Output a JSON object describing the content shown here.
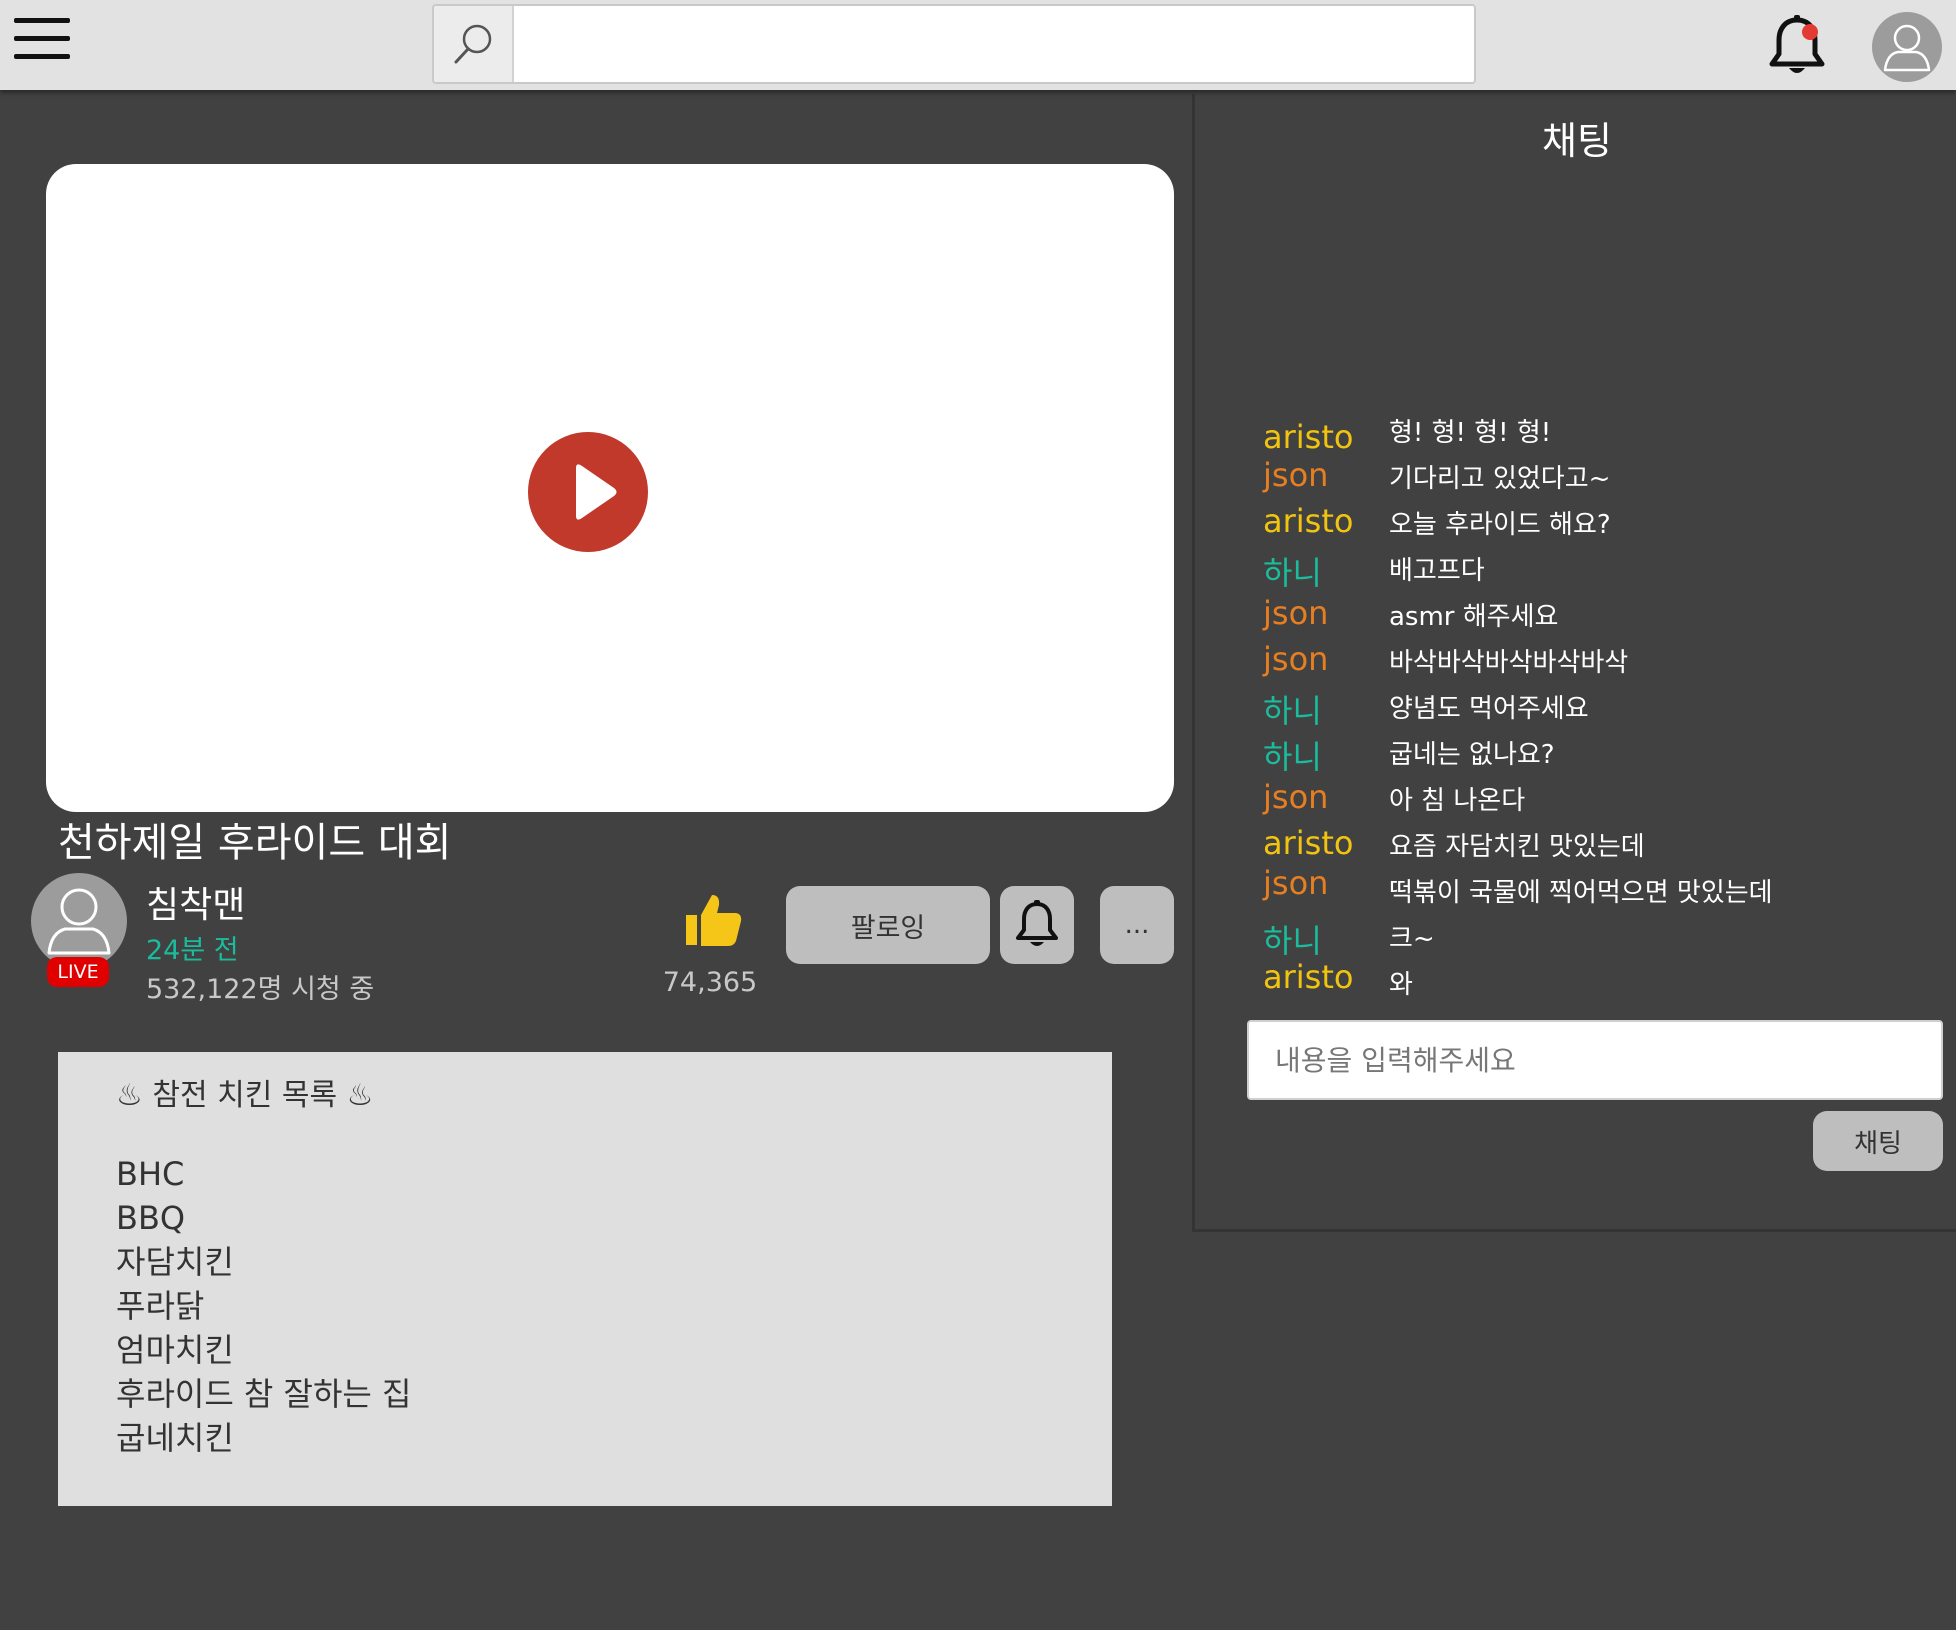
{
  "header": {
    "menu_icon": "hamburger-menu-icon",
    "search_icon": "search-icon",
    "search_value": "",
    "notification_icon": "bell-icon",
    "notification_dot_color": "#e53935",
    "profile_icon": "user-avatar-icon"
  },
  "video": {
    "play_icon": "play-icon",
    "play_color": "#c0392b",
    "title": "천하제일 후라이드 대회"
  },
  "channel": {
    "name": "침착맨",
    "time": "24분 전",
    "viewers": "532,122명 시청 중",
    "live_label": "LIVE",
    "live_color": "#e10000"
  },
  "actions": {
    "like_icon": "thumbs-up-icon",
    "like_color": "#f5c518",
    "like_count": "74,365",
    "follow_label": "팔로잉",
    "bell_icon": "bell-icon",
    "more_label": "..."
  },
  "description": {
    "heading": "♨ 참전 치킨 목록 ♨",
    "items": [
      "BHC",
      "BBQ",
      "자담치킨",
      "푸라닭",
      "엄마치킨",
      "후라이드 참 잘하는 집",
      "굽네치킨"
    ]
  },
  "chat": {
    "title": "채팅",
    "user_colors": {
      "aristo": "#f1c40f",
      "json": "#e67e22",
      "하니": "#1abc9c"
    },
    "messages": [
      {
        "user": "aristo",
        "text": "형! 형! 형! 형!"
      },
      {
        "user": "json",
        "text": "기다리고 있었다고~"
      },
      {
        "user": "aristo",
        "text": "오늘 후라이드 해요?"
      },
      {
        "user": "하니",
        "text": "배고프다"
      },
      {
        "user": "json",
        "text": "asmr 해주세요"
      },
      {
        "user": "json",
        "text": "바삭바삭바삭바삭바삭"
      },
      {
        "user": "하니",
        "text": "양념도 먹어주세요"
      },
      {
        "user": "하니",
        "text": "굽네는 없나요?"
      },
      {
        "user": "json",
        "text": "아 침 나온다"
      },
      {
        "user": "aristo",
        "text": "요즘 자담치킨 맛있는데"
      },
      {
        "user": "json",
        "text": "떡볶이 국물에 찍어먹으면 맛있는데"
      },
      {
        "user": "하니",
        "text": "크~"
      },
      {
        "user": "aristo",
        "text": "와"
      }
    ],
    "input_placeholder": "내용을 입력해주세요",
    "input_value": "",
    "send_label": "채팅"
  }
}
